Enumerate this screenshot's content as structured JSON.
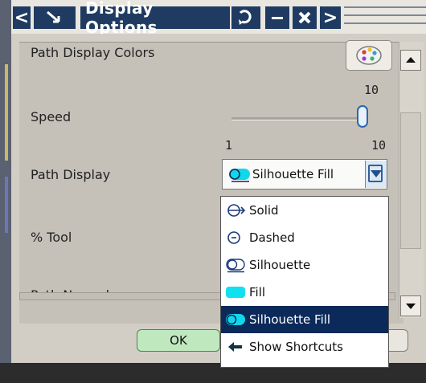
{
  "window": {
    "title": "Display Options",
    "nav_left": "<",
    "nav_right": ">",
    "collapse_icon": "collapse-icon",
    "minimize_icon": "minimize-icon",
    "close_icon": "close-icon"
  },
  "fields": {
    "path_display_colors_label": "Path Display Colors",
    "speed_label": "Speed",
    "speed_value": "10",
    "speed_min": "1",
    "speed_max": "10",
    "speed_level": 1.0,
    "path_display_label": "Path Display",
    "path_display_value": "Silhouette Fill",
    "percent_tool_label": "% Tool",
    "path_normal_label": "Path Normal"
  },
  "dropdown": {
    "items": [
      {
        "label": "Solid",
        "icon": "solid-icon"
      },
      {
        "label": "Dashed",
        "icon": "dashed-icon"
      },
      {
        "label": "Silhouette",
        "icon": "silhouette-icon"
      },
      {
        "label": "Fill",
        "icon": "fill-icon"
      },
      {
        "label": "Silhouette Fill",
        "icon": "silhouette-fill-icon",
        "selected": true
      },
      {
        "label": "Show Shortcuts",
        "icon": "show-shortcuts-icon"
      }
    ]
  },
  "buttons": {
    "ok_label": "OK"
  },
  "colors": {
    "title_bar": "#1f3b62",
    "ok_button": "#bfe8bf",
    "selection": "#0b2a5a",
    "fill_accent": "#11e0f0"
  }
}
